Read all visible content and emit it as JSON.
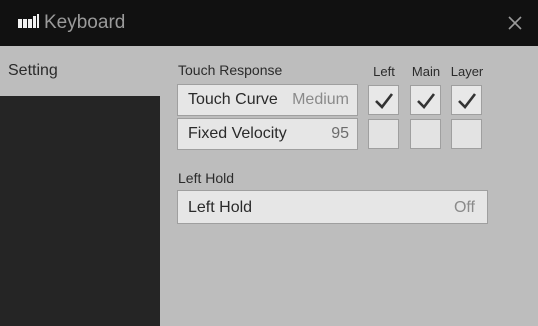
{
  "window": {
    "title": "Keyboard",
    "logo_icon": "keyboard-logo-icon",
    "close_icon": "close-icon"
  },
  "sidebar": {
    "items": [
      {
        "label": "Setting",
        "active": true
      }
    ]
  },
  "touch_response": {
    "label": "Touch Response",
    "columns": [
      "Left",
      "Main",
      "Layer"
    ],
    "touch_curve": {
      "name": "Touch Curve",
      "value": "Medium",
      "checks": [
        true,
        true,
        true
      ]
    },
    "fixed_velocity": {
      "name": "Fixed Velocity",
      "value": "95",
      "checks": [
        false,
        false,
        false
      ]
    }
  },
  "left_hold": {
    "label": "Left Hold",
    "row": {
      "name": "Left Hold",
      "value": "Off"
    }
  },
  "colors": {
    "titlebar": "#111111",
    "sidebar": "#252525",
    "panel": "#bdbdbd",
    "button": "#e6e6e6"
  }
}
